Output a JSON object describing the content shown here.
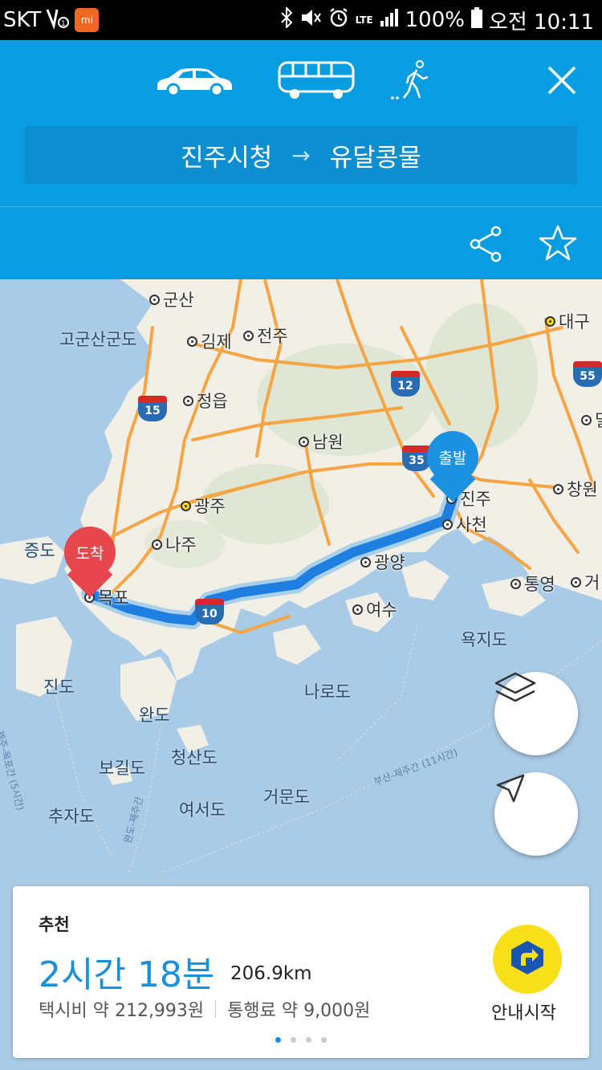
{
  "status_bar": {
    "carrier": "SKT",
    "battery": "100%",
    "time": "오전 10:11",
    "lte": "LTE",
    "icons": [
      "signal-hd-icon",
      "mi-app-icon",
      "bluetooth-icon",
      "mute-icon",
      "alarm-icon",
      "lte-icon",
      "signal-icon",
      "battery-icon"
    ]
  },
  "header": {
    "modes": [
      "car-icon",
      "bus-icon",
      "walk-icon"
    ],
    "origin": "진주시청",
    "destination": "유달콩물",
    "arrow": "→",
    "colors": {
      "background": "#0a9ce0",
      "route_box": "#0d8ed0"
    }
  },
  "map": {
    "cities": [
      {
        "name": "군산"
      },
      {
        "name": "김제"
      },
      {
        "name": "전주"
      },
      {
        "name": "대구"
      },
      {
        "name": "정읍"
      },
      {
        "name": "남원"
      },
      {
        "name": "광주"
      },
      {
        "name": "진주"
      },
      {
        "name": "창원"
      },
      {
        "name": "사천"
      },
      {
        "name": "나주"
      },
      {
        "name": "광양"
      },
      {
        "name": "목포"
      },
      {
        "name": "통영"
      },
      {
        "name": "거"
      },
      {
        "name": "여수"
      },
      {
        "name": "밀"
      }
    ],
    "islands": [
      "고군산군도",
      "증도",
      "욕지도",
      "진도",
      "나로도",
      "완도",
      "청산도",
      "보길도",
      "거문도",
      "여서도",
      "추자도"
    ],
    "sea_routes": [
      "제주-목포간 (5시간)",
      "완도-제주간",
      "부산-제주간 (11시간)"
    ],
    "highways": [
      "15",
      "12",
      "55",
      "35",
      "10"
    ],
    "pins": {
      "start": "출발",
      "end": "도착"
    },
    "route_color": "#1e7fe0"
  },
  "card": {
    "label": "추천",
    "duration": "2시간 18분",
    "distance": "206.9km",
    "taxi_fare": "택시비 약 212,993원",
    "toll": "통행료 약 9,000원",
    "nav_label": "안내시작",
    "page_count": 4,
    "active_page": 1
  }
}
